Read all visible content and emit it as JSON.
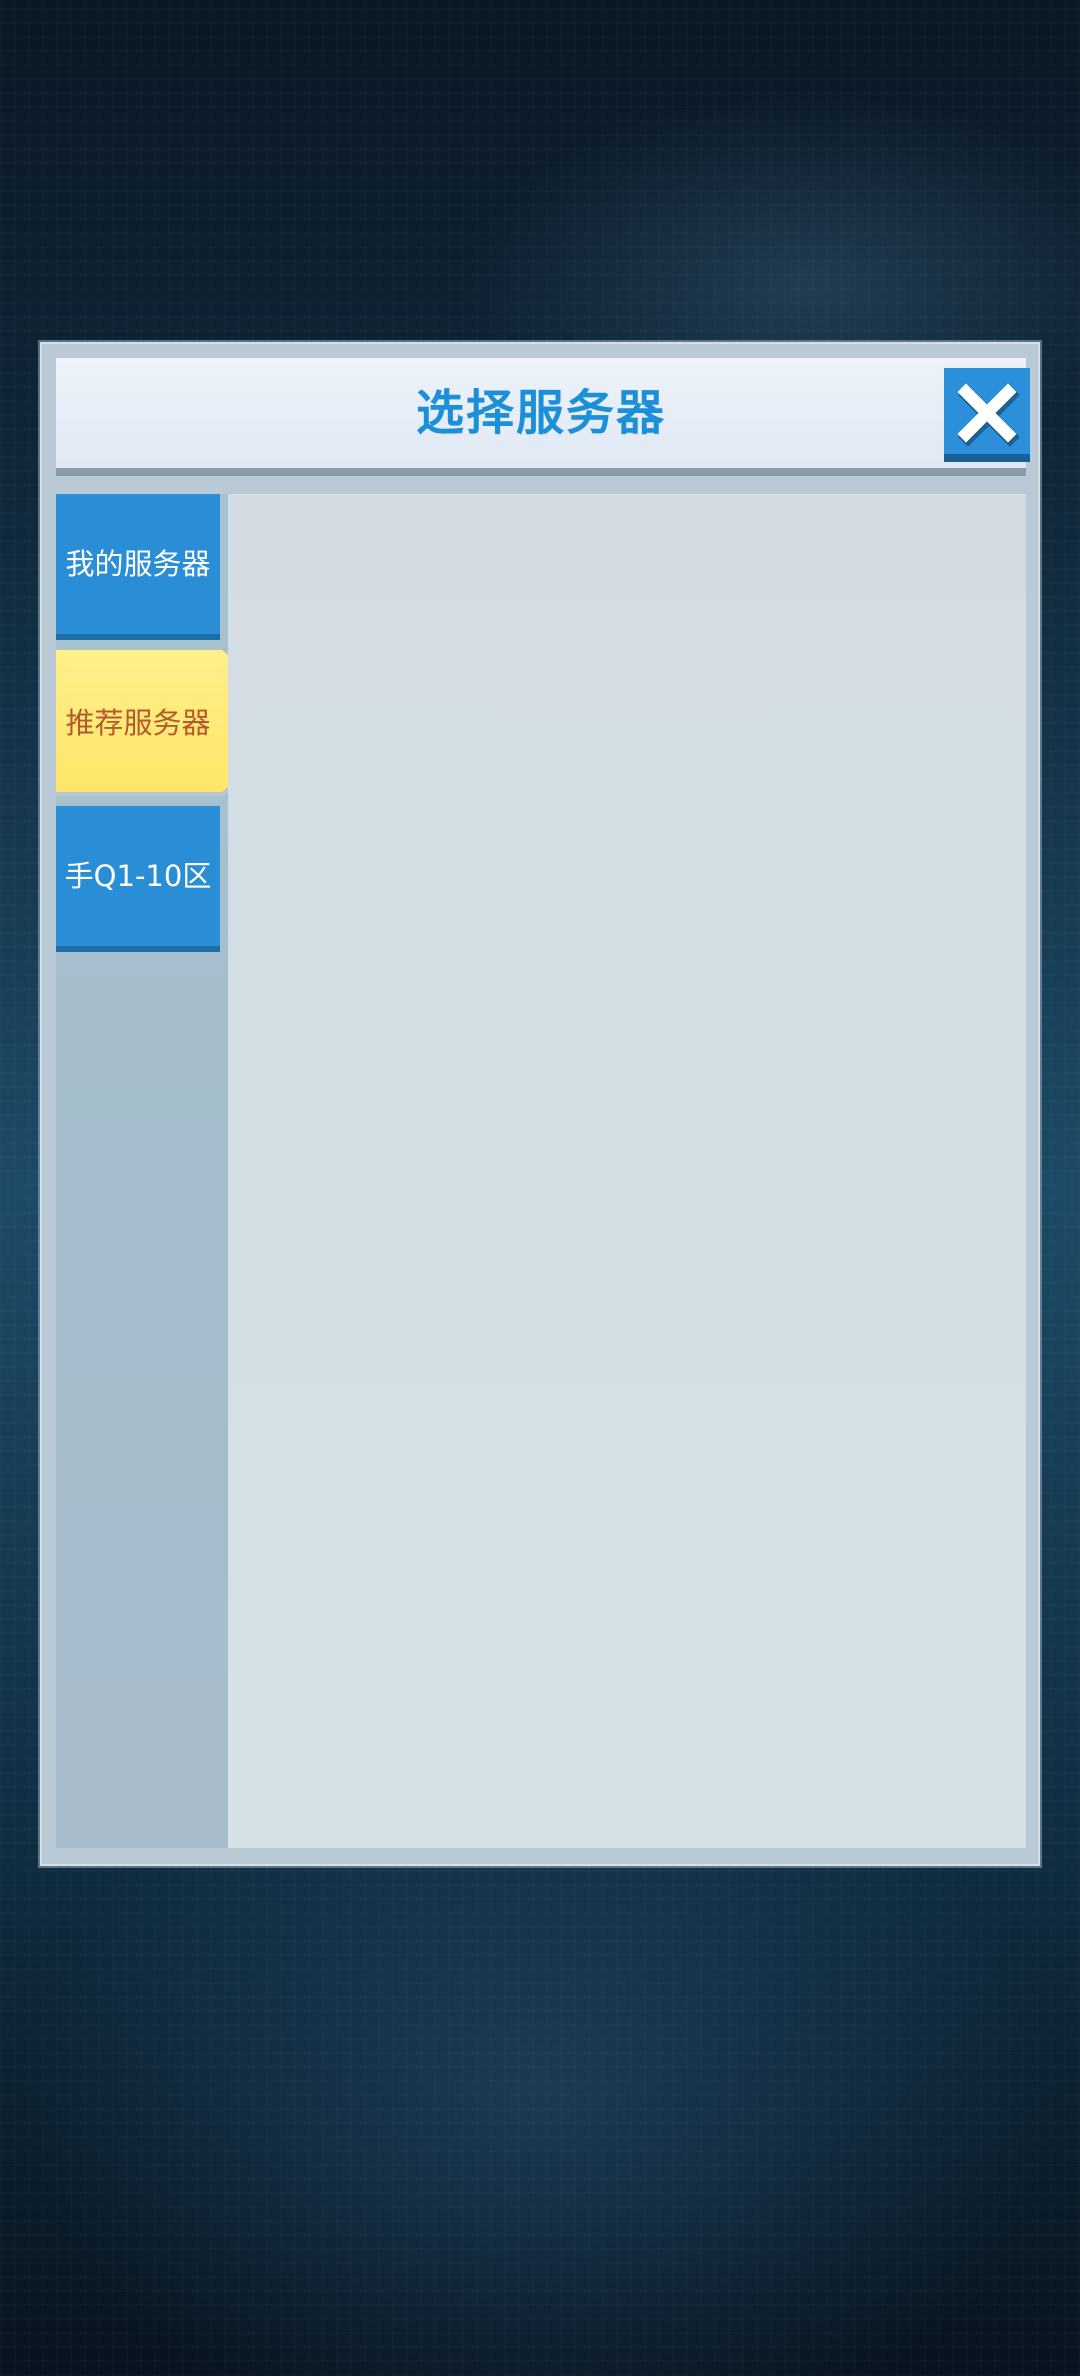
{
  "dialog": {
    "title": "选择服务器",
    "close_icon": "close-x-icon"
  },
  "sidebar": {
    "tabs": [
      {
        "label": "我的服务器",
        "selected": false
      },
      {
        "label": "推荐服务器",
        "selected": true
      },
      {
        "label": "手Q1-10区",
        "selected": false
      }
    ]
  },
  "colors": {
    "accent_blue": "#2a8ed6",
    "selected_yellow": "#ffe97a",
    "title_blue": "#1b8fd8",
    "selected_text": "#b55a2a"
  }
}
